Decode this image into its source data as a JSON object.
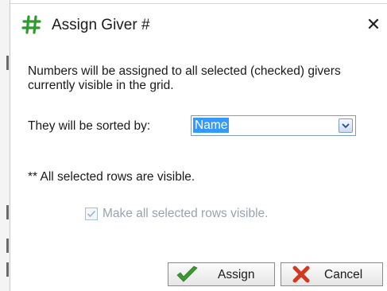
{
  "dialog": {
    "title": "Assign Giver #",
    "close_glyph": "✕",
    "description": "Numbers will be assigned to all selected (checked) givers currently visible in the grid.",
    "sort_label": "They will be sorted by:",
    "sort_value": "Name",
    "visible_note": "** All selected rows are visible.",
    "make_visible_label": "Make all selected rows visible.",
    "make_visible_checked": true,
    "make_visible_enabled": false,
    "buttons": {
      "assign": "Assign",
      "cancel": "Cancel"
    },
    "icons": {
      "title": "hash-icon",
      "assign": "green-checkmark-icon",
      "cancel": "red-x-icon"
    },
    "colors": {
      "selection": "#3399ff",
      "disabled_text": "#9aa3ad"
    }
  }
}
